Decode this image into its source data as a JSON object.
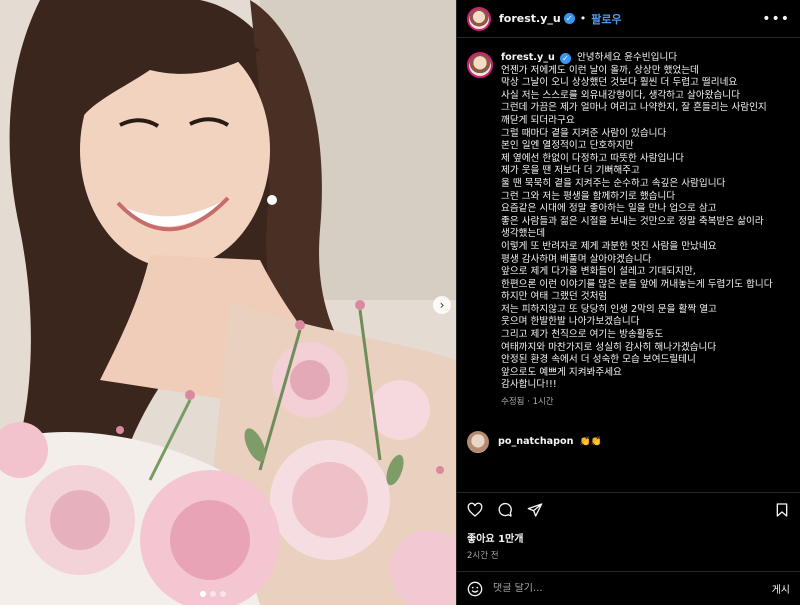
{
  "post": {
    "username": "forest.y_u",
    "verified_glyph": "✓",
    "separator": "•",
    "follow_label": "팔로우",
    "more_glyph": "•••",
    "carousel_next_glyph": "›",
    "caption_lines": [
      "안녕하세요 윤수빈입니다",
      "언젠가 저에게도 이런 날이 올까, 상상만 했었는데",
      "막상 그날이 오니 상상했던 것보다 훨씬 더 두렵고 떨리네요",
      "",
      "사실 저는 스스로를 외유내강형이다, 생각하고 살아왔습니다",
      "그런데 가끔은 제가 얼마나 여리고 나약한지, 잘 흔들리는 사람인지",
      "깨닫게 되더라구요",
      "그럴 때마다 곁을 지켜준 사람이 있습니다",
      "본인 일엔 열정적이고 단호하지만",
      "제 옆에선 한없이 다정하고 따뜻한 사람입니다",
      "제가 웃을 땐 저보다 더 기뻐해주고",
      "울 땐 묵묵히 곁을 지켜주는 순수하고 속깊은 사람입니다",
      "그런 그와 저는 평생을 함께하기로 했습니다",
      "",
      "요즘같은 시대에 정말 좋아하는 일을 만나 업으로 삼고",
      "좋은 사람들과 젊은 시절을 보내는 것만으로 정말 축복받은 삶이라",
      "생각했는데",
      "이렇게 또 반려자로 제게 과분한 멋진 사람을 만났네요",
      "평생 감사하며 베풀며 살아야겠습니다",
      "",
      "앞으로 제게 다가올 변화들이 설레고 기대되지만,",
      "한편으론 이런 이야기를 많은 분들 앞에 꺼내놓는게 두렵기도 합니다",
      "하지만 여태 그랬던 것처럼",
      "저는 피하지않고 또 당당히 인생 2막의 문을 활짝 열고",
      "웃으며 한발한발 나아가보겠습니다",
      "",
      "그리고 제가 천직으로 여기는 방송활동도",
      "여태까지와 마찬가지로 성실히 감사히 해나가겠습니다",
      "안정된 환경 속에서 더 성숙한 모습 보여드릴테니",
      "앞으로도 예쁘게 지켜봐주세요",
      "감사합니다!!!"
    ],
    "caption_meta": "수정됨 · 1시간",
    "comment": {
      "username": "po_natchapon",
      "text": "👏👏"
    },
    "likes": "좋아요 1만개",
    "timestamp": "2시간 전",
    "comment_placeholder": "댓글 달기...",
    "post_label": "게시"
  },
  "colors": {
    "follow": "#4b9cf0",
    "verified": "#3897f0",
    "avatar_ring": "#ce1f7a",
    "muted_text": "#a8a8a8"
  },
  "icons": [
    "heart-icon",
    "comment-icon",
    "share-icon",
    "bookmark-icon",
    "emoji-icon",
    "more-icon",
    "verified-icon"
  ]
}
